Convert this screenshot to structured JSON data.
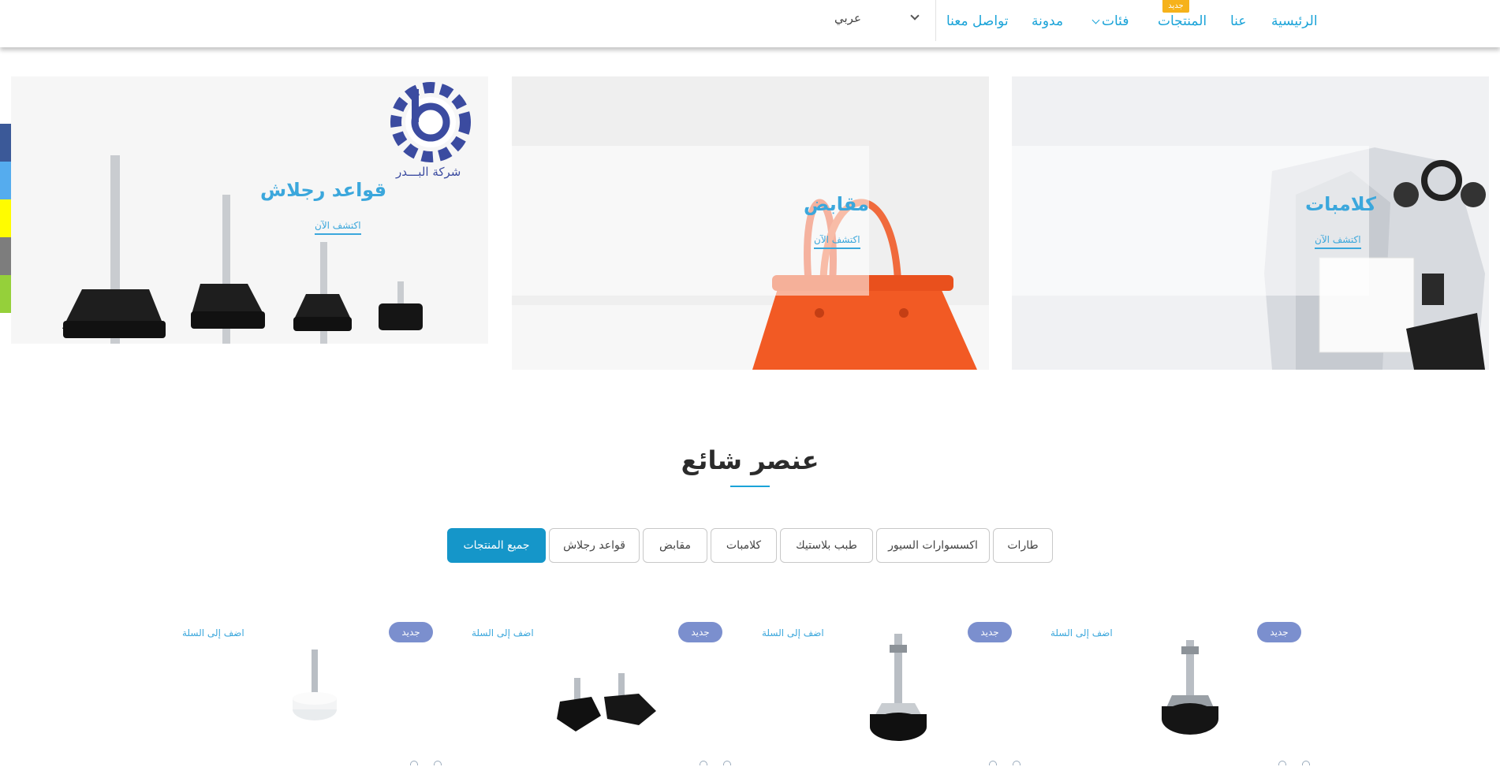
{
  "nav": {
    "items": [
      "الرئيسية",
      "عنا",
      "المنتجات",
      "فئات",
      "مدونة",
      "تواصل معنا"
    ],
    "new_badge": "جديد",
    "language": "عربي"
  },
  "social": {
    "icons": [
      "facebook-icon",
      "twitter-icon",
      "snapchat-icon",
      "email-icon",
      "share-icon"
    ],
    "colors": [
      "#3b5998",
      "#55acee",
      "#fffc00",
      "#7d7d7d",
      "#95d03a"
    ]
  },
  "banners": [
    {
      "title": "كلامبات",
      "link": "اكتشف الآن"
    },
    {
      "title": "مقابض",
      "link": "اكتشف الآن"
    },
    {
      "title": "قواعد رجلاش",
      "link": "اكتشف الآن",
      "logo_text": "شركة البـــدر"
    }
  ],
  "featured": {
    "title": "عنصر شائع",
    "tabs": [
      "طارات",
      "اكسسوارات السيور",
      "طبب بلاستيك",
      "كلامبات",
      "مقابض",
      "قواعد رجلاش",
      "جميع المنتجات"
    ],
    "active_tab": "جميع المنتجات"
  },
  "products": [
    {
      "badge": "جديد",
      "add_to_cart": "اضف إلى السلة"
    },
    {
      "badge": "جديد",
      "add_to_cart": "اضف إلى السلة"
    },
    {
      "badge": "جديد",
      "add_to_cart": "اضف إلى السلة"
    },
    {
      "badge": "جديد",
      "add_to_cart": "اضف إلى السلة"
    }
  ],
  "colors": {
    "accent": "#1aa3d8",
    "active_tab": "#1596c9",
    "badge": "#7b8fce",
    "new_tag": "#f6b21a"
  }
}
